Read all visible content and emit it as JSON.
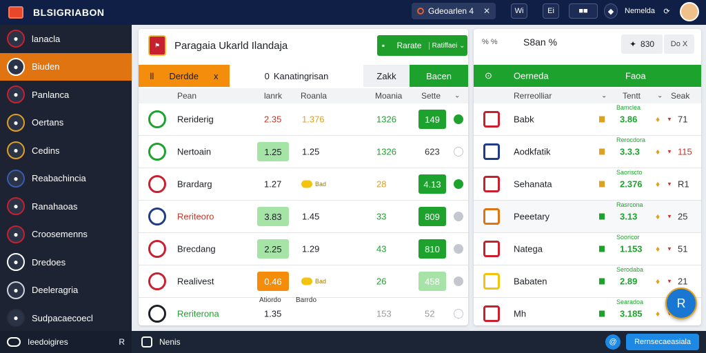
{
  "app": {
    "title": "BLSIGRIABON"
  },
  "topbar": {
    "search_value": "Gdeoarlen 4",
    "user_name": "Nemelda",
    "icon1": "Wi",
    "icon2": "Ei"
  },
  "sidebar": {
    "items": [
      {
        "label": "lanacla",
        "icon": "flag-icon",
        "color": "#c8202f"
      },
      {
        "label": "Biuden",
        "icon": "ball-icon",
        "color": "#ffffff",
        "active": true
      },
      {
        "label": "Panlanca",
        "icon": "stroke-icon",
        "color": "#c8202f"
      },
      {
        "label": "Oertans",
        "icon": "bars-icon",
        "color": "#e0a020"
      },
      {
        "label": "Cedins",
        "icon": "crest-icon",
        "color": "#e0a020"
      },
      {
        "label": "Reabachincia",
        "icon": "shield-icon",
        "color": "#3a5cb0"
      },
      {
        "label": "Ranahaoas",
        "icon": "badge-icon",
        "color": "#c8202f"
      },
      {
        "label": "Croosemenns",
        "icon": "crest-icon",
        "color": "#c8202f"
      },
      {
        "label": "Dredoes",
        "icon": "shield-icon",
        "color": "#ffffff"
      },
      {
        "label": "Deeleragria",
        "icon": "gear-icon",
        "color": "#d0d4dc"
      },
      {
        "label": "Sudpacaecoecl",
        "icon": "star-icon",
        "color": "#2a2f3b"
      }
    ]
  },
  "main": {
    "match_title": "Paragaia Ukarld Ilandaja",
    "green_button": "Rarate",
    "green_button_sub": "Ratiffaei",
    "tabs": [
      {
        "label": "Derdde",
        "prefix": "ll",
        "suffix": "x"
      },
      {
        "label": "Kanatingrisan",
        "prefix": "0"
      },
      {
        "label": "Zakk"
      },
      {
        "label": "Bacen"
      }
    ],
    "columns": {
      "c1": "Pean",
      "c2": "lanrk",
      "c3": "Roanla",
      "c4": "Moania",
      "c5": "Sette"
    },
    "rows": [
      {
        "name": "Reriderig",
        "v1": "2.35",
        "v2": "1.376",
        "v3": "1326",
        "v4": "149",
        "status": "green",
        "colors": {
          "v1": "#c0392b",
          "v2": "#e0a020",
          "v3": "#1da22e"
        }
      },
      {
        "name": "Nertoain",
        "v1": "1.25",
        "v2": "1.25",
        "v3": "1326",
        "v4": "623",
        "status": "empty"
      },
      {
        "name": "Brardarg",
        "v1": "1.27",
        "v2": "Bad",
        "v3": "28",
        "v4": "4.13",
        "status": "green"
      },
      {
        "name": "Reriteoro",
        "v1": "3.83",
        "v2": "1.45",
        "v3": "33",
        "v4": "809",
        "status": "grey"
      },
      {
        "name": "Brecdang",
        "v1": "2.25",
        "v2": "1.29",
        "v3": "43",
        "v4": "810",
        "status": "grey"
      },
      {
        "name": "Realivest",
        "v1": "0.46",
        "v2": "Bad",
        "v3": "26",
        "v4": "458",
        "status": "grey"
      },
      {
        "name": "Reriterona",
        "v1": "1.35",
        "v1_top": "Atiordo",
        "v2": "",
        "v2_top": "Barrdo",
        "v3": "153",
        "v4": "52",
        "status": "empty"
      }
    ]
  },
  "right": {
    "top_left": "% %",
    "top_center": "S8an %",
    "btn1": "830",
    "btn2": "Do X",
    "tab1": "Oerneda",
    "tab2": "Faoa",
    "columns": {
      "c1": "Rerreolliar",
      "c2": "Tentt",
      "c3": "Seak"
    },
    "rows": [
      {
        "name": "Babk",
        "label": "Bamclea",
        "value": "3.86",
        "count": "71"
      },
      {
        "name": "Aodkfatik",
        "label": "Rerocdora",
        "value": "3.3.3",
        "count": "115"
      },
      {
        "name": "Sehanata",
        "label": "Saoriscto",
        "value": "2.376",
        "count": "R1"
      },
      {
        "name": "Peeetary",
        "label": "Rasrcona",
        "value": "3.13",
        "count": "25"
      },
      {
        "name": "Natega",
        "label": "Sooricor",
        "value": "1.153",
        "count": "51"
      },
      {
        "name": "Babaten",
        "label": "Serodaba",
        "value": "2.89",
        "count": "21"
      },
      {
        "name": "Mh",
        "label": "Searadoa",
        "value": "3.185",
        "count": ""
      }
    ]
  },
  "bottombar": {
    "left_label": "Ieedoigires",
    "left_icon_r": "R",
    "mid_label": "Nenis",
    "button": "Rernsecaeasiala",
    "circle": "@"
  },
  "fab_label": "R",
  "colors": {
    "accent_orange": "#e07410",
    "green": "#1da22e",
    "navy": "#0f1f45",
    "sidebar": "#1d2332"
  }
}
